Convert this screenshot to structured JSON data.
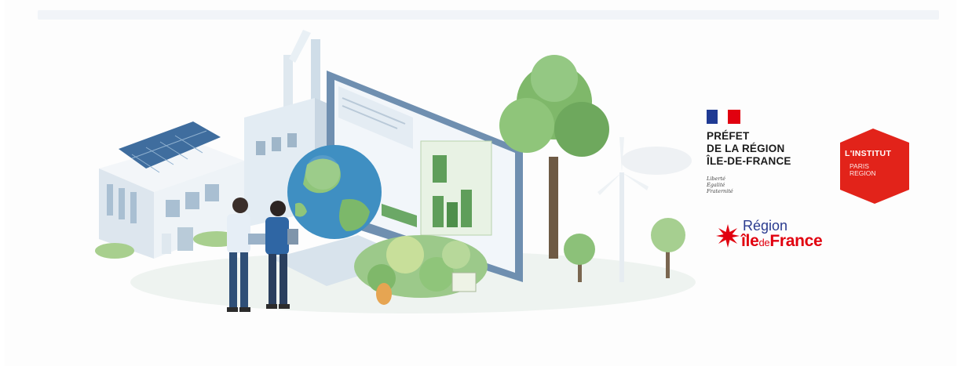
{
  "banner": {
    "prefet": {
      "line1": "PRÉFET",
      "line2": "DE LA RÉGION",
      "line3": "ÎLE-DE-FRANCE",
      "devise": [
        "Liberté",
        "Égalité",
        "Fraternité"
      ]
    },
    "institut": {
      "line1": "L'INSTITUT",
      "line2": "PARIS",
      "line3": "REGION"
    },
    "region": {
      "line1": "Région",
      "part_ile": "île",
      "part_de": "de",
      "part_france": "France"
    }
  },
  "colors": {
    "marianne_blue": "#1f3a93",
    "marianne_red": "#e1000f",
    "institut_red": "#e2231a",
    "region_blue": "#2a3b8f",
    "region_red": "#e1000f",
    "leaf_green": "#7fb86a",
    "building": "#e6eef5"
  },
  "icons": [
    "marianne-flag-icon",
    "institut-hexagon-logo",
    "region-star-icon",
    "globe-icon",
    "wind-turbine-icon"
  ]
}
